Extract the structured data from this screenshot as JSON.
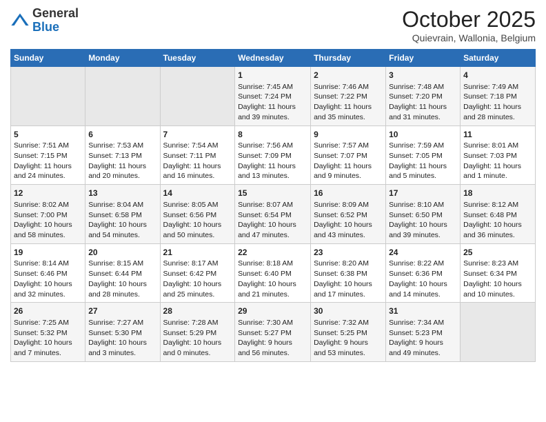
{
  "header": {
    "logo_general": "General",
    "logo_blue": "Blue",
    "month_title": "October 2025",
    "location": "Quievrain, Wallonia, Belgium"
  },
  "days_of_week": [
    "Sunday",
    "Monday",
    "Tuesday",
    "Wednesday",
    "Thursday",
    "Friday",
    "Saturday"
  ],
  "weeks": [
    [
      {
        "day": "",
        "content": ""
      },
      {
        "day": "",
        "content": ""
      },
      {
        "day": "",
        "content": ""
      },
      {
        "day": "1",
        "content": "Sunrise: 7:45 AM\nSunset: 7:24 PM\nDaylight: 11 hours\nand 39 minutes."
      },
      {
        "day": "2",
        "content": "Sunrise: 7:46 AM\nSunset: 7:22 PM\nDaylight: 11 hours\nand 35 minutes."
      },
      {
        "day": "3",
        "content": "Sunrise: 7:48 AM\nSunset: 7:20 PM\nDaylight: 11 hours\nand 31 minutes."
      },
      {
        "day": "4",
        "content": "Sunrise: 7:49 AM\nSunset: 7:18 PM\nDaylight: 11 hours\nand 28 minutes."
      }
    ],
    [
      {
        "day": "5",
        "content": "Sunrise: 7:51 AM\nSunset: 7:15 PM\nDaylight: 11 hours\nand 24 minutes."
      },
      {
        "day": "6",
        "content": "Sunrise: 7:53 AM\nSunset: 7:13 PM\nDaylight: 11 hours\nand 20 minutes."
      },
      {
        "day": "7",
        "content": "Sunrise: 7:54 AM\nSunset: 7:11 PM\nDaylight: 11 hours\nand 16 minutes."
      },
      {
        "day": "8",
        "content": "Sunrise: 7:56 AM\nSunset: 7:09 PM\nDaylight: 11 hours\nand 13 minutes."
      },
      {
        "day": "9",
        "content": "Sunrise: 7:57 AM\nSunset: 7:07 PM\nDaylight: 11 hours\nand 9 minutes."
      },
      {
        "day": "10",
        "content": "Sunrise: 7:59 AM\nSunset: 7:05 PM\nDaylight: 11 hours\nand 5 minutes."
      },
      {
        "day": "11",
        "content": "Sunrise: 8:01 AM\nSunset: 7:03 PM\nDaylight: 11 hours\nand 1 minute."
      }
    ],
    [
      {
        "day": "12",
        "content": "Sunrise: 8:02 AM\nSunset: 7:00 PM\nDaylight: 10 hours\nand 58 minutes."
      },
      {
        "day": "13",
        "content": "Sunrise: 8:04 AM\nSunset: 6:58 PM\nDaylight: 10 hours\nand 54 minutes."
      },
      {
        "day": "14",
        "content": "Sunrise: 8:05 AM\nSunset: 6:56 PM\nDaylight: 10 hours\nand 50 minutes."
      },
      {
        "day": "15",
        "content": "Sunrise: 8:07 AM\nSunset: 6:54 PM\nDaylight: 10 hours\nand 47 minutes."
      },
      {
        "day": "16",
        "content": "Sunrise: 8:09 AM\nSunset: 6:52 PM\nDaylight: 10 hours\nand 43 minutes."
      },
      {
        "day": "17",
        "content": "Sunrise: 8:10 AM\nSunset: 6:50 PM\nDaylight: 10 hours\nand 39 minutes."
      },
      {
        "day": "18",
        "content": "Sunrise: 8:12 AM\nSunset: 6:48 PM\nDaylight: 10 hours\nand 36 minutes."
      }
    ],
    [
      {
        "day": "19",
        "content": "Sunrise: 8:14 AM\nSunset: 6:46 PM\nDaylight: 10 hours\nand 32 minutes."
      },
      {
        "day": "20",
        "content": "Sunrise: 8:15 AM\nSunset: 6:44 PM\nDaylight: 10 hours\nand 28 minutes."
      },
      {
        "day": "21",
        "content": "Sunrise: 8:17 AM\nSunset: 6:42 PM\nDaylight: 10 hours\nand 25 minutes."
      },
      {
        "day": "22",
        "content": "Sunrise: 8:18 AM\nSunset: 6:40 PM\nDaylight: 10 hours\nand 21 minutes."
      },
      {
        "day": "23",
        "content": "Sunrise: 8:20 AM\nSunset: 6:38 PM\nDaylight: 10 hours\nand 17 minutes."
      },
      {
        "day": "24",
        "content": "Sunrise: 8:22 AM\nSunset: 6:36 PM\nDaylight: 10 hours\nand 14 minutes."
      },
      {
        "day": "25",
        "content": "Sunrise: 8:23 AM\nSunset: 6:34 PM\nDaylight: 10 hours\nand 10 minutes."
      }
    ],
    [
      {
        "day": "26",
        "content": "Sunrise: 7:25 AM\nSunset: 5:32 PM\nDaylight: 10 hours\nand 7 minutes."
      },
      {
        "day": "27",
        "content": "Sunrise: 7:27 AM\nSunset: 5:30 PM\nDaylight: 10 hours\nand 3 minutes."
      },
      {
        "day": "28",
        "content": "Sunrise: 7:28 AM\nSunset: 5:29 PM\nDaylight: 10 hours\nand 0 minutes."
      },
      {
        "day": "29",
        "content": "Sunrise: 7:30 AM\nSunset: 5:27 PM\nDaylight: 9 hours\nand 56 minutes."
      },
      {
        "day": "30",
        "content": "Sunrise: 7:32 AM\nSunset: 5:25 PM\nDaylight: 9 hours\nand 53 minutes."
      },
      {
        "day": "31",
        "content": "Sunrise: 7:34 AM\nSunset: 5:23 PM\nDaylight: 9 hours\nand 49 minutes."
      },
      {
        "day": "",
        "content": ""
      }
    ]
  ]
}
